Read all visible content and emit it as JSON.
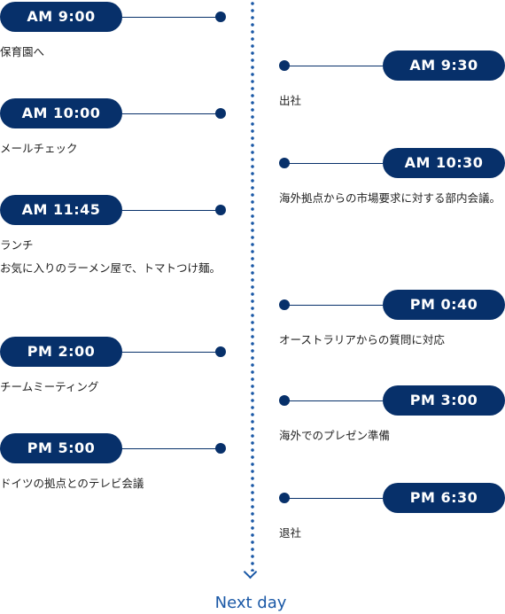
{
  "left": [
    {
      "time": "AM 9:00",
      "text": "保育園へ"
    },
    {
      "time": "AM 10:00",
      "text": "メールチェック"
    },
    {
      "time": "AM 11:45",
      "text": "ランチ",
      "sub": "お気に入りのラーメン屋で、トマトつけ麺。"
    },
    {
      "time": "PM 2:00",
      "text": "チームミーティング"
    },
    {
      "time": "PM 5:00",
      "text": "ドイツの拠点とのテレビ会議"
    }
  ],
  "right": [
    {
      "time": "AM 9:30",
      "text": "出社"
    },
    {
      "time": "AM 10:30",
      "text": "海外拠点からの市場要求に対する部内会議。"
    },
    {
      "time": "PM 0:40",
      "text": "オーストラリアからの質問に対応"
    },
    {
      "time": "PM 3:00",
      "text": "海外でのプレゼン準備"
    },
    {
      "time": "PM 6:30",
      "text": "退社"
    }
  ],
  "next_day": "Next day",
  "colors": {
    "pill": "#07306a",
    "timeline": "#1a58a6"
  }
}
